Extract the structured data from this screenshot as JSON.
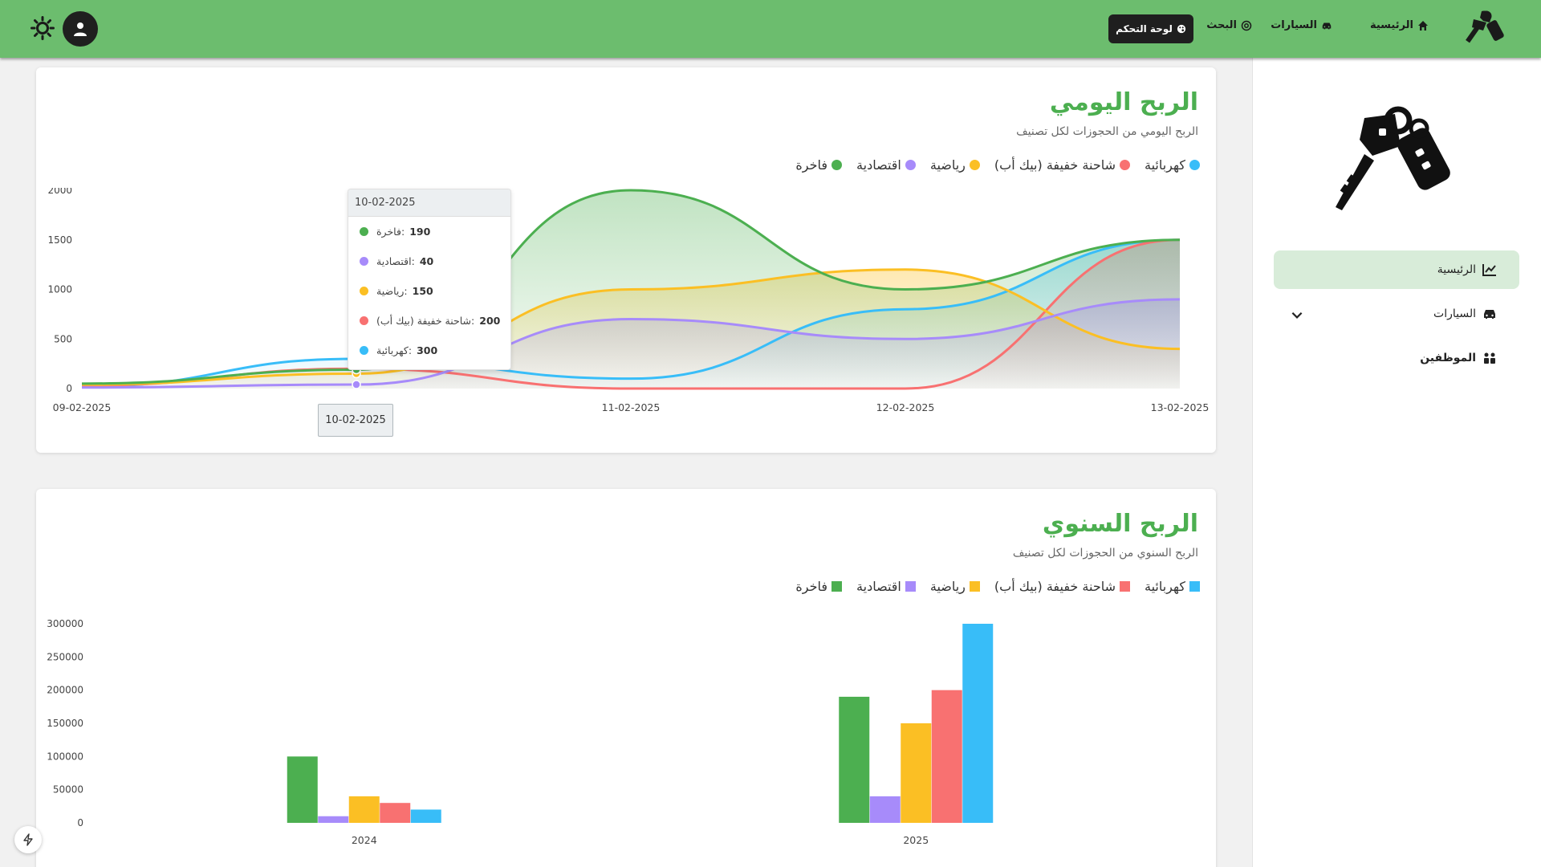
{
  "topbar": {
    "nav": {
      "home": "الرئيسية",
      "cars": "السيارات",
      "search": "البحث",
      "dashboard": "لوحة التحكم"
    }
  },
  "sidebar": {
    "items": [
      {
        "label": "الرئيسية",
        "icon": "chart-line-icon"
      },
      {
        "label": "السيارات",
        "icon": "car-icon"
      },
      {
        "label": "الموظفين",
        "icon": "users-icon"
      }
    ]
  },
  "colors": {
    "fakhira": "#4caf50",
    "iqtisadiya": "#a78bfa",
    "riyadiya": "#fbbf24",
    "pickup": "#f87171",
    "kahraba": "#38bdf8"
  },
  "daily": {
    "title": "الربح اليومي",
    "subtitle": "الربح اليومي من الحجوزات لكل تصنيف",
    "tooltip": {
      "date": "10-02-2025",
      "rows": [
        {
          "label": "فاخرة:",
          "value": "190",
          "color": "#4caf50"
        },
        {
          "label": "اقتصادية:",
          "value": "40",
          "color": "#a78bfa"
        },
        {
          "label": "رياضية:",
          "value": "150",
          "color": "#fbbf24"
        },
        {
          "label": "شاحنة خفيفة (بيك أب):",
          "value": "200",
          "color": "#f87171"
        },
        {
          "label": "كهربائية:",
          "value": "300",
          "color": "#38bdf8"
        }
      ],
      "x_label": "10-02-2025"
    }
  },
  "yearly": {
    "title": "الربح السنوي",
    "subtitle": "الربح السنوي من الحجوزات لكل تصنيف"
  },
  "chart_data": [
    {
      "type": "area",
      "categories": [
        "09-02-2025",
        "10-02-2025",
        "11-02-2025",
        "12-02-2025",
        "13-02-2025"
      ],
      "ylim": [
        0,
        2000
      ],
      "yticks": [
        "0",
        "500",
        "1000",
        "1500",
        "2000"
      ],
      "series": [
        {
          "name": "كهربائية",
          "color": "#38bdf8",
          "values": [
            20,
            300,
            100,
            800,
            1500
          ]
        },
        {
          "name": "شاحنة خفيفة (بيك أب)",
          "color": "#f87171",
          "values": [
            30,
            200,
            0,
            0,
            1500
          ]
        },
        {
          "name": "رياضية",
          "color": "#fbbf24",
          "values": [
            40,
            150,
            1000,
            1200,
            400
          ]
        },
        {
          "name": "اقتصادية",
          "color": "#a78bfa",
          "values": [
            10,
            40,
            700,
            500,
            900
          ]
        },
        {
          "name": "فاخرة",
          "color": "#4caf50",
          "values": [
            50,
            190,
            2000,
            1000,
            1500
          ]
        }
      ],
      "grid": false,
      "legend": "top-right"
    },
    {
      "type": "bar",
      "categories": [
        "2024",
        "2025"
      ],
      "ylim": [
        0,
        300000
      ],
      "yticks": [
        "0",
        "50000",
        "100000",
        "150000",
        "200000",
        "250000",
        "300000"
      ],
      "series": [
        {
          "name": "فاخرة",
          "color": "#4caf50",
          "values": [
            100000,
            190000
          ]
        },
        {
          "name": "اقتصادية",
          "color": "#a78bfa",
          "values": [
            10000,
            40000
          ]
        },
        {
          "name": "رياضية",
          "color": "#fbbf24",
          "values": [
            40000,
            150000
          ]
        },
        {
          "name": "شاحنة خفيفة (بيك أب)",
          "color": "#f87171",
          "values": [
            30000,
            200000
          ]
        },
        {
          "name": "كهربائية",
          "color": "#38bdf8",
          "values": [
            20000,
            300000
          ]
        }
      ],
      "grid": false,
      "legend": "top-right"
    }
  ]
}
